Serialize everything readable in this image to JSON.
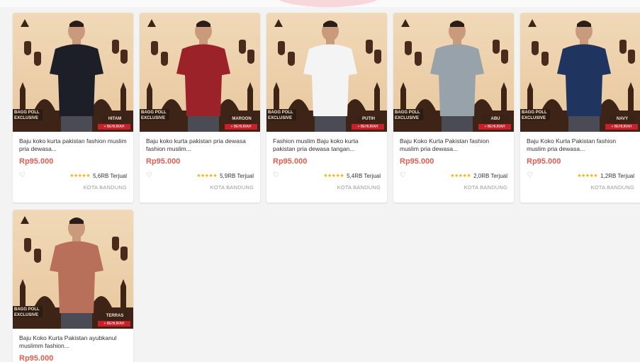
{
  "products": [
    {
      "title": "Baju koko kurta pakistan fashion muslim pria dewasa...",
      "price": "Rp95.000",
      "sold": "5,6RB Terjual",
      "rating_stars": "★★★★★",
      "location": "KOTA BANDUNG",
      "tag": "HITAM",
      "banner": "BAGG POLL EXCLUSIVE",
      "red_tag": "+ BEHIJRAH",
      "shirt_color": "#1c1f27"
    },
    {
      "title": "Baju koko kurta pakistan pria dewasa fashion muslim...",
      "price": "Rp95.000",
      "sold": "5,9RB Terjual",
      "rating_stars": "★★★★★",
      "location": "KOTA BANDUNG",
      "tag": "MAROON",
      "banner": "BAGG POLL EXCLUSIVE",
      "red_tag": "+ BEHIJRAH",
      "shirt_color": "#9b2229"
    },
    {
      "title": "Fashion muslim Baju koko kurta pakistan pria dewasa tangan...",
      "price": "Rp95.000",
      "sold": "5,4RB Terjual",
      "rating_stars": "★★★★★",
      "location": "KOTA BANDUNG",
      "tag": "PUTIH",
      "banner": "BAGG POLL EXCLUSIVE",
      "red_tag": "+ BEHIJRAH",
      "shirt_color": "#f4f4f4"
    },
    {
      "title": "Baju Koko Kurta Pakistan fashion muslim pria dewasa...",
      "price": "Rp95.000",
      "sold": "2,0RB Terjual",
      "rating_stars": "★★★★★",
      "location": "KOTA BANDUNG",
      "tag": "ABU",
      "banner": "BAGG POLL EXCLUSIVE",
      "red_tag": "+ BEHIJRAH",
      "shirt_color": "#98a2ab"
    },
    {
      "title": "Baju Koko Kurta Pakistan fashion muslim pria dewasa...",
      "price": "Rp95.000",
      "sold": "1,2RB Terjual",
      "rating_stars": "★★★★★",
      "location": "KOTA BANDUNG",
      "tag": "NAVY",
      "banner": "BAGG POLL EXCLUSIVE",
      "red_tag": "+ BEHIJRAH",
      "shirt_color": "#1f3560"
    },
    {
      "title": "Baju Koko Kurta Pakistan ayubkanul muslimm fashion...",
      "price": "Rp95.000",
      "sold": "",
      "rating_stars": "",
      "location": "",
      "tag": "TERRAS",
      "banner": "BAGG POLL EXCLUSIVE",
      "red_tag": "+ BEHIJRAH",
      "shirt_color": "#b8705a"
    }
  ]
}
